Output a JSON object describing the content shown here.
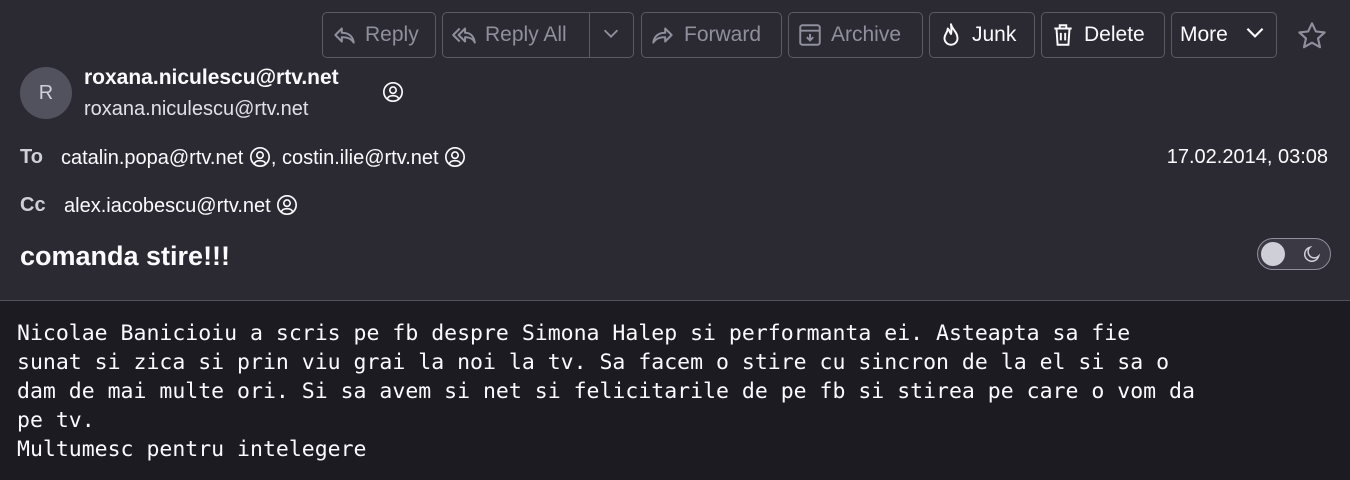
{
  "toolbar": {
    "reply": "Reply",
    "reply_all": "Reply All",
    "forward": "Forward",
    "archive": "Archive",
    "junk": "Junk",
    "delete": "Delete",
    "more": "More"
  },
  "message": {
    "avatar_initial": "R",
    "from_name": "roxana.niculescu@rtv.net",
    "from_address": "roxana.niculescu@rtv.net",
    "to_label": "To",
    "to": [
      "catalin.popa@rtv.net",
      "costin.ilie@rtv.net"
    ],
    "cc_label": "Cc",
    "cc": [
      "alex.iacobescu@rtv.net"
    ],
    "date": "17.02.2014, 03:08",
    "subject": "comanda stire!!!",
    "body": "Nicolae Banicioiu a scris pe fb despre Simona Halep si performanta ei. Asteapta sa fie\nsunat si zica si prin viu grai la noi la tv. Sa facem o stire cu sincron de la el si sa o\ndam de mai multe ori. Si sa avem si net si felicitarile de pe fb si stirea pe care o vom da\npe tv.\nMultumesc pentru intelegere"
  },
  "icons": {
    "reply": "reply-icon",
    "reply_all": "reply-all-icon",
    "forward": "forward-icon",
    "archive": "archive-icon",
    "junk": "flame-icon",
    "delete": "trash-icon",
    "star": "star-icon",
    "contact": "address-book-icon",
    "theme_toggle": "moon-icon"
  },
  "colors": {
    "header_bg": "#2b2a33",
    "body_bg": "#1c1b22",
    "text": "#fbfbfe",
    "disabled_text": "#8f8f9d",
    "button_border": "#5b5b66"
  }
}
